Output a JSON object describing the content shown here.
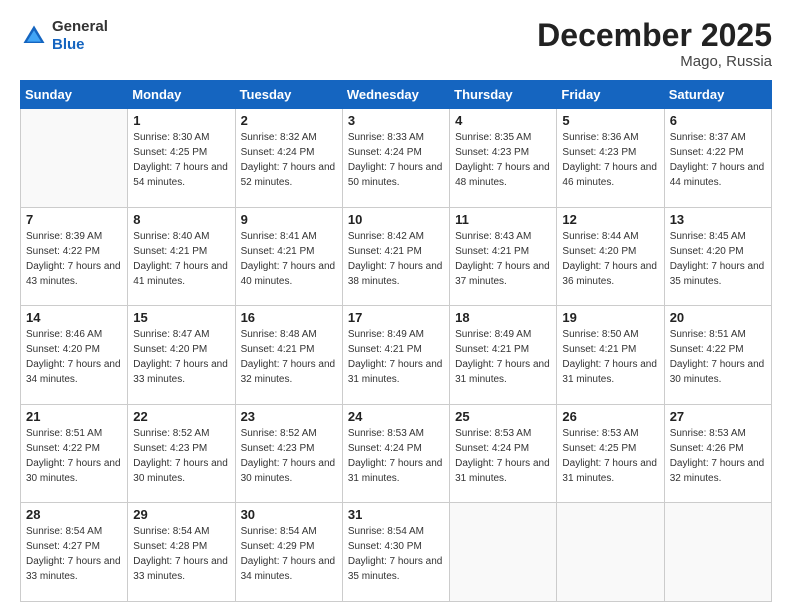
{
  "header": {
    "logo": {
      "general": "General",
      "blue": "Blue"
    },
    "title": "December 2025",
    "location": "Mago, Russia"
  },
  "weekdays": [
    "Sunday",
    "Monday",
    "Tuesday",
    "Wednesday",
    "Thursday",
    "Friday",
    "Saturday"
  ],
  "weeks": [
    [
      {
        "day": "",
        "sunrise": "",
        "sunset": "",
        "daylight": ""
      },
      {
        "day": "1",
        "sunrise": "Sunrise: 8:30 AM",
        "sunset": "Sunset: 4:25 PM",
        "daylight": "Daylight: 7 hours and 54 minutes."
      },
      {
        "day": "2",
        "sunrise": "Sunrise: 8:32 AM",
        "sunset": "Sunset: 4:24 PM",
        "daylight": "Daylight: 7 hours and 52 minutes."
      },
      {
        "day": "3",
        "sunrise": "Sunrise: 8:33 AM",
        "sunset": "Sunset: 4:24 PM",
        "daylight": "Daylight: 7 hours and 50 minutes."
      },
      {
        "day": "4",
        "sunrise": "Sunrise: 8:35 AM",
        "sunset": "Sunset: 4:23 PM",
        "daylight": "Daylight: 7 hours and 48 minutes."
      },
      {
        "day": "5",
        "sunrise": "Sunrise: 8:36 AM",
        "sunset": "Sunset: 4:23 PM",
        "daylight": "Daylight: 7 hours and 46 minutes."
      },
      {
        "day": "6",
        "sunrise": "Sunrise: 8:37 AM",
        "sunset": "Sunset: 4:22 PM",
        "daylight": "Daylight: 7 hours and 44 minutes."
      }
    ],
    [
      {
        "day": "7",
        "sunrise": "Sunrise: 8:39 AM",
        "sunset": "Sunset: 4:22 PM",
        "daylight": "Daylight: 7 hours and 43 minutes."
      },
      {
        "day": "8",
        "sunrise": "Sunrise: 8:40 AM",
        "sunset": "Sunset: 4:21 PM",
        "daylight": "Daylight: 7 hours and 41 minutes."
      },
      {
        "day": "9",
        "sunrise": "Sunrise: 8:41 AM",
        "sunset": "Sunset: 4:21 PM",
        "daylight": "Daylight: 7 hours and 40 minutes."
      },
      {
        "day": "10",
        "sunrise": "Sunrise: 8:42 AM",
        "sunset": "Sunset: 4:21 PM",
        "daylight": "Daylight: 7 hours and 38 minutes."
      },
      {
        "day": "11",
        "sunrise": "Sunrise: 8:43 AM",
        "sunset": "Sunset: 4:21 PM",
        "daylight": "Daylight: 7 hours and 37 minutes."
      },
      {
        "day": "12",
        "sunrise": "Sunrise: 8:44 AM",
        "sunset": "Sunset: 4:20 PM",
        "daylight": "Daylight: 7 hours and 36 minutes."
      },
      {
        "day": "13",
        "sunrise": "Sunrise: 8:45 AM",
        "sunset": "Sunset: 4:20 PM",
        "daylight": "Daylight: 7 hours and 35 minutes."
      }
    ],
    [
      {
        "day": "14",
        "sunrise": "Sunrise: 8:46 AM",
        "sunset": "Sunset: 4:20 PM",
        "daylight": "Daylight: 7 hours and 34 minutes."
      },
      {
        "day": "15",
        "sunrise": "Sunrise: 8:47 AM",
        "sunset": "Sunset: 4:20 PM",
        "daylight": "Daylight: 7 hours and 33 minutes."
      },
      {
        "day": "16",
        "sunrise": "Sunrise: 8:48 AM",
        "sunset": "Sunset: 4:21 PM",
        "daylight": "Daylight: 7 hours and 32 minutes."
      },
      {
        "day": "17",
        "sunrise": "Sunrise: 8:49 AM",
        "sunset": "Sunset: 4:21 PM",
        "daylight": "Daylight: 7 hours and 31 minutes."
      },
      {
        "day": "18",
        "sunrise": "Sunrise: 8:49 AM",
        "sunset": "Sunset: 4:21 PM",
        "daylight": "Daylight: 7 hours and 31 minutes."
      },
      {
        "day": "19",
        "sunrise": "Sunrise: 8:50 AM",
        "sunset": "Sunset: 4:21 PM",
        "daylight": "Daylight: 7 hours and 31 minutes."
      },
      {
        "day": "20",
        "sunrise": "Sunrise: 8:51 AM",
        "sunset": "Sunset: 4:22 PM",
        "daylight": "Daylight: 7 hours and 30 minutes."
      }
    ],
    [
      {
        "day": "21",
        "sunrise": "Sunrise: 8:51 AM",
        "sunset": "Sunset: 4:22 PM",
        "daylight": "Daylight: 7 hours and 30 minutes."
      },
      {
        "day": "22",
        "sunrise": "Sunrise: 8:52 AM",
        "sunset": "Sunset: 4:23 PM",
        "daylight": "Daylight: 7 hours and 30 minutes."
      },
      {
        "day": "23",
        "sunrise": "Sunrise: 8:52 AM",
        "sunset": "Sunset: 4:23 PM",
        "daylight": "Daylight: 7 hours and 30 minutes."
      },
      {
        "day": "24",
        "sunrise": "Sunrise: 8:53 AM",
        "sunset": "Sunset: 4:24 PM",
        "daylight": "Daylight: 7 hours and 31 minutes."
      },
      {
        "day": "25",
        "sunrise": "Sunrise: 8:53 AM",
        "sunset": "Sunset: 4:24 PM",
        "daylight": "Daylight: 7 hours and 31 minutes."
      },
      {
        "day": "26",
        "sunrise": "Sunrise: 8:53 AM",
        "sunset": "Sunset: 4:25 PM",
        "daylight": "Daylight: 7 hours and 31 minutes."
      },
      {
        "day": "27",
        "sunrise": "Sunrise: 8:53 AM",
        "sunset": "Sunset: 4:26 PM",
        "daylight": "Daylight: 7 hours and 32 minutes."
      }
    ],
    [
      {
        "day": "28",
        "sunrise": "Sunrise: 8:54 AM",
        "sunset": "Sunset: 4:27 PM",
        "daylight": "Daylight: 7 hours and 33 minutes."
      },
      {
        "day": "29",
        "sunrise": "Sunrise: 8:54 AM",
        "sunset": "Sunset: 4:28 PM",
        "daylight": "Daylight: 7 hours and 33 minutes."
      },
      {
        "day": "30",
        "sunrise": "Sunrise: 8:54 AM",
        "sunset": "Sunset: 4:29 PM",
        "daylight": "Daylight: 7 hours and 34 minutes."
      },
      {
        "day": "31",
        "sunrise": "Sunrise: 8:54 AM",
        "sunset": "Sunset: 4:30 PM",
        "daylight": "Daylight: 7 hours and 35 minutes."
      },
      {
        "day": "",
        "sunrise": "",
        "sunset": "",
        "daylight": ""
      },
      {
        "day": "",
        "sunrise": "",
        "sunset": "",
        "daylight": ""
      },
      {
        "day": "",
        "sunrise": "",
        "sunset": "",
        "daylight": ""
      }
    ]
  ]
}
